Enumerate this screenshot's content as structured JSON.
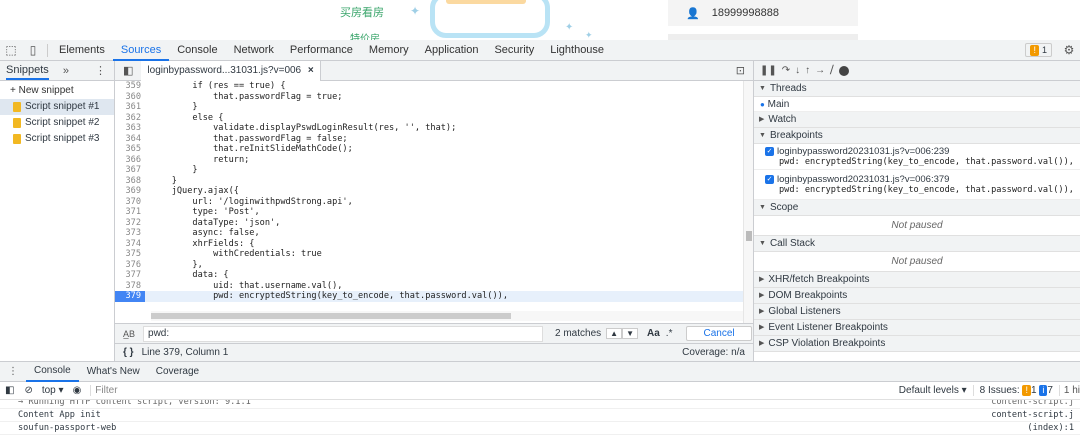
{
  "webpage": {
    "link1": "买房看房",
    "link2": "特价房",
    "phone": "18999998888"
  },
  "devtools_tabs": [
    "Elements",
    "Sources",
    "Console",
    "Network",
    "Performance",
    "Memory",
    "Application",
    "Security",
    "Lighthouse"
  ],
  "issues_count": "1",
  "navigator": {
    "tab": "Snippets",
    "new_snippet": "+ New snippet",
    "snippets": [
      "Script snippet #1",
      "Script snippet #2",
      "Script snippet #3"
    ]
  },
  "editor": {
    "file_tab": "loginbypassword...31031.js?v=006",
    "lines": [
      {
        "n": "359",
        "code": "        if (res == true) {"
      },
      {
        "n": "360",
        "code": "            that.passwordFlag = true;"
      },
      {
        "n": "361",
        "code": "        }"
      },
      {
        "n": "362",
        "code": "        else {"
      },
      {
        "n": "363",
        "code": "            validate.displayPswdLoginResult(res, '', that);"
      },
      {
        "n": "364",
        "code": "            that.passwordFlag = false;"
      },
      {
        "n": "365",
        "code": "            that.reInitSlideMathCode();"
      },
      {
        "n": "366",
        "code": "            return;"
      },
      {
        "n": "367",
        "code": "        }"
      },
      {
        "n": "368",
        "code": "    }"
      },
      {
        "n": "369",
        "code": "    jQuery.ajax({"
      },
      {
        "n": "370",
        "code": "        url: '/loginwithpwdStrong.api',"
      },
      {
        "n": "371",
        "code": "        type: 'Post',"
      },
      {
        "n": "372",
        "code": "        dataType: 'json',"
      },
      {
        "n": "373",
        "code": "        async: false,"
      },
      {
        "n": "374",
        "code": "        xhrFields: {"
      },
      {
        "n": "375",
        "code": "            withCredentials: true"
      },
      {
        "n": "376",
        "code": "        },"
      },
      {
        "n": "377",
        "code": "        data: {"
      },
      {
        "n": "378",
        "code": "            uid: that.username.val(),"
      },
      {
        "n": "379",
        "code": "            pwd: encryptedString(key_to_encode, that.password.val()),"
      }
    ],
    "search_query": "pwd:",
    "match_count": "2 matches",
    "case_btn": "Aa",
    "regex_btn": ".*",
    "cancel_label": "Cancel",
    "position": "Line 379, Column 1",
    "coverage": "Coverage: n/a"
  },
  "debugger": {
    "threads_label": "Threads",
    "main_thread": "Main",
    "watch_label": "Watch",
    "breakpoints_label": "Breakpoints",
    "breakpoints": [
      {
        "file": "loginbypassword20231031.js?v=006:239",
        "code": "pwd: encryptedString(key_to_encode, that.password.val()),"
      },
      {
        "file": "loginbypassword20231031.js?v=006:379",
        "code": "pwd: encryptedString(key_to_encode, that.password.val()),"
      }
    ],
    "scope_label": "Scope",
    "not_paused_1": "Not paused",
    "callstack_label": "Call Stack",
    "not_paused_2": "Not paused",
    "xhr_label": "XHR/fetch Breakpoints",
    "dom_label": "DOM Breakpoints",
    "global_label": "Global Listeners",
    "event_label": "Event Listener Breakpoints",
    "csp_label": "CSP Violation Breakpoints"
  },
  "drawer": {
    "tabs": [
      "Console",
      "What's New",
      "Coverage"
    ],
    "context": "top",
    "filter_placeholder": "Filter",
    "levels": "Default levels",
    "issues_label": "8 Issues:",
    "issues_warn": "1",
    "issues_info": "7",
    "hidden": "1 hi",
    "lines": [
      {
        "text": "→ Running HTTP content script, version: 9.1.1",
        "src": "content-script.j"
      },
      {
        "text": "Content App init",
        "src": "content-script.j"
      },
      {
        "text": "soufun-passport-web",
        "src": "(index):1"
      }
    ]
  },
  "colors": {
    "accent": "#1a73e8",
    "breakpoint": "#4285f4",
    "panel_bg": "#f1f3f4"
  }
}
